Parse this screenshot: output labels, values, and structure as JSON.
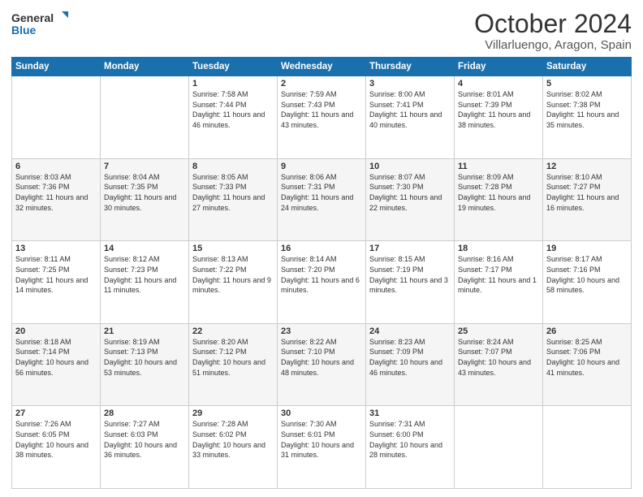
{
  "logo": {
    "text_general": "General",
    "text_blue": "Blue"
  },
  "header": {
    "title": "October 2024",
    "subtitle": "Villarluengo, Aragon, Spain"
  },
  "weekdays": [
    "Sunday",
    "Monday",
    "Tuesday",
    "Wednesday",
    "Thursday",
    "Friday",
    "Saturday"
  ],
  "weeks": [
    [
      {
        "day": "",
        "sunrise": "",
        "sunset": "",
        "daylight": ""
      },
      {
        "day": "",
        "sunrise": "",
        "sunset": "",
        "daylight": ""
      },
      {
        "day": "1",
        "sunrise": "Sunrise: 7:58 AM",
        "sunset": "Sunset: 7:44 PM",
        "daylight": "Daylight: 11 hours and 46 minutes."
      },
      {
        "day": "2",
        "sunrise": "Sunrise: 7:59 AM",
        "sunset": "Sunset: 7:43 PM",
        "daylight": "Daylight: 11 hours and 43 minutes."
      },
      {
        "day": "3",
        "sunrise": "Sunrise: 8:00 AM",
        "sunset": "Sunset: 7:41 PM",
        "daylight": "Daylight: 11 hours and 40 minutes."
      },
      {
        "day": "4",
        "sunrise": "Sunrise: 8:01 AM",
        "sunset": "Sunset: 7:39 PM",
        "daylight": "Daylight: 11 hours and 38 minutes."
      },
      {
        "day": "5",
        "sunrise": "Sunrise: 8:02 AM",
        "sunset": "Sunset: 7:38 PM",
        "daylight": "Daylight: 11 hours and 35 minutes."
      }
    ],
    [
      {
        "day": "6",
        "sunrise": "Sunrise: 8:03 AM",
        "sunset": "Sunset: 7:36 PM",
        "daylight": "Daylight: 11 hours and 32 minutes."
      },
      {
        "day": "7",
        "sunrise": "Sunrise: 8:04 AM",
        "sunset": "Sunset: 7:35 PM",
        "daylight": "Daylight: 11 hours and 30 minutes."
      },
      {
        "day": "8",
        "sunrise": "Sunrise: 8:05 AM",
        "sunset": "Sunset: 7:33 PM",
        "daylight": "Daylight: 11 hours and 27 minutes."
      },
      {
        "day": "9",
        "sunrise": "Sunrise: 8:06 AM",
        "sunset": "Sunset: 7:31 PM",
        "daylight": "Daylight: 11 hours and 24 minutes."
      },
      {
        "day": "10",
        "sunrise": "Sunrise: 8:07 AM",
        "sunset": "Sunset: 7:30 PM",
        "daylight": "Daylight: 11 hours and 22 minutes."
      },
      {
        "day": "11",
        "sunrise": "Sunrise: 8:09 AM",
        "sunset": "Sunset: 7:28 PM",
        "daylight": "Daylight: 11 hours and 19 minutes."
      },
      {
        "day": "12",
        "sunrise": "Sunrise: 8:10 AM",
        "sunset": "Sunset: 7:27 PM",
        "daylight": "Daylight: 11 hours and 16 minutes."
      }
    ],
    [
      {
        "day": "13",
        "sunrise": "Sunrise: 8:11 AM",
        "sunset": "Sunset: 7:25 PM",
        "daylight": "Daylight: 11 hours and 14 minutes."
      },
      {
        "day": "14",
        "sunrise": "Sunrise: 8:12 AM",
        "sunset": "Sunset: 7:23 PM",
        "daylight": "Daylight: 11 hours and 11 minutes."
      },
      {
        "day": "15",
        "sunrise": "Sunrise: 8:13 AM",
        "sunset": "Sunset: 7:22 PM",
        "daylight": "Daylight: 11 hours and 9 minutes."
      },
      {
        "day": "16",
        "sunrise": "Sunrise: 8:14 AM",
        "sunset": "Sunset: 7:20 PM",
        "daylight": "Daylight: 11 hours and 6 minutes."
      },
      {
        "day": "17",
        "sunrise": "Sunrise: 8:15 AM",
        "sunset": "Sunset: 7:19 PM",
        "daylight": "Daylight: 11 hours and 3 minutes."
      },
      {
        "day": "18",
        "sunrise": "Sunrise: 8:16 AM",
        "sunset": "Sunset: 7:17 PM",
        "daylight": "Daylight: 11 hours and 1 minute."
      },
      {
        "day": "19",
        "sunrise": "Sunrise: 8:17 AM",
        "sunset": "Sunset: 7:16 PM",
        "daylight": "Daylight: 10 hours and 58 minutes."
      }
    ],
    [
      {
        "day": "20",
        "sunrise": "Sunrise: 8:18 AM",
        "sunset": "Sunset: 7:14 PM",
        "daylight": "Daylight: 10 hours and 56 minutes."
      },
      {
        "day": "21",
        "sunrise": "Sunrise: 8:19 AM",
        "sunset": "Sunset: 7:13 PM",
        "daylight": "Daylight: 10 hours and 53 minutes."
      },
      {
        "day": "22",
        "sunrise": "Sunrise: 8:20 AM",
        "sunset": "Sunset: 7:12 PM",
        "daylight": "Daylight: 10 hours and 51 minutes."
      },
      {
        "day": "23",
        "sunrise": "Sunrise: 8:22 AM",
        "sunset": "Sunset: 7:10 PM",
        "daylight": "Daylight: 10 hours and 48 minutes."
      },
      {
        "day": "24",
        "sunrise": "Sunrise: 8:23 AM",
        "sunset": "Sunset: 7:09 PM",
        "daylight": "Daylight: 10 hours and 46 minutes."
      },
      {
        "day": "25",
        "sunrise": "Sunrise: 8:24 AM",
        "sunset": "Sunset: 7:07 PM",
        "daylight": "Daylight: 10 hours and 43 minutes."
      },
      {
        "day": "26",
        "sunrise": "Sunrise: 8:25 AM",
        "sunset": "Sunset: 7:06 PM",
        "daylight": "Daylight: 10 hours and 41 minutes."
      }
    ],
    [
      {
        "day": "27",
        "sunrise": "Sunrise: 7:26 AM",
        "sunset": "Sunset: 6:05 PM",
        "daylight": "Daylight: 10 hours and 38 minutes."
      },
      {
        "day": "28",
        "sunrise": "Sunrise: 7:27 AM",
        "sunset": "Sunset: 6:03 PM",
        "daylight": "Daylight: 10 hours and 36 minutes."
      },
      {
        "day": "29",
        "sunrise": "Sunrise: 7:28 AM",
        "sunset": "Sunset: 6:02 PM",
        "daylight": "Daylight: 10 hours and 33 minutes."
      },
      {
        "day": "30",
        "sunrise": "Sunrise: 7:30 AM",
        "sunset": "Sunset: 6:01 PM",
        "daylight": "Daylight: 10 hours and 31 minutes."
      },
      {
        "day": "31",
        "sunrise": "Sunrise: 7:31 AM",
        "sunset": "Sunset: 6:00 PM",
        "daylight": "Daylight: 10 hours and 28 minutes."
      },
      {
        "day": "",
        "sunrise": "",
        "sunset": "",
        "daylight": ""
      },
      {
        "day": "",
        "sunrise": "",
        "sunset": "",
        "daylight": ""
      }
    ]
  ]
}
